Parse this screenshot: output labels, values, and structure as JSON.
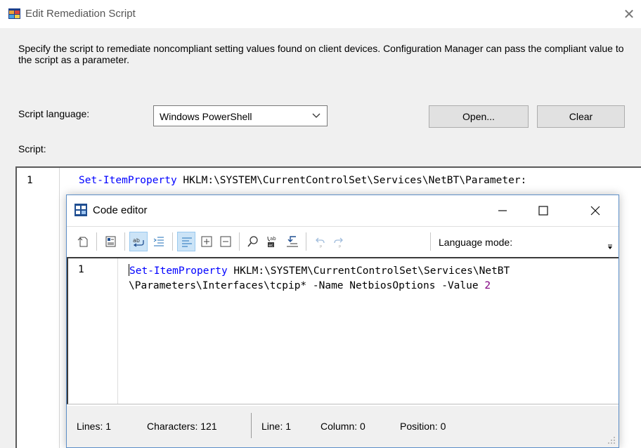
{
  "dialog": {
    "title": "Edit Remediation Script",
    "description": "Specify the script to remediate noncompliant setting values found on client devices. Configuration Manager can pass the compliant value to the script as a parameter.",
    "script_language_label": "Script language:",
    "script_language_value": "Windows PowerShell",
    "open_label": "Open...",
    "clear_label": "Clear",
    "script_label": "Script:"
  },
  "script_editor": {
    "line_number": "1",
    "code_keyword": "Set-ItemProperty",
    "code_rest": " HKLM:\\SYSTEM\\CurrentControlSet\\Services\\NetBT\\Parameter:"
  },
  "code_editor": {
    "title": "Code editor",
    "language_mode_label": "Language mode:",
    "line_number": "1",
    "code_keyword": "Set-ItemProperty",
    "code_line1_rest": " HKLM:\\SYSTEM\\CurrentControlSet\\Services\\NetBT",
    "code_line2": "\\Parameters\\Interfaces\\tcpip* -Name NetbiosOptions -Value ",
    "code_value": "2",
    "status": {
      "lines": "Lines: 1",
      "characters": "Characters: 121",
      "line": "Line: 1",
      "column": "Column: 0",
      "position": "Position: 0"
    }
  },
  "colors": {
    "keyword": "#0000ff",
    "number": "#800080",
    "toggle_on": "#cce4f7"
  },
  "icons": [
    "app-icon",
    "chevron-down-icon",
    "code-editor-icon",
    "minimize-icon",
    "maximize-icon",
    "close-icon",
    "new-document-icon",
    "properties-icon",
    "word-wrap-icon",
    "indent-icon",
    "align-icon",
    "expand-icon",
    "collapse-icon",
    "find-icon",
    "replace-icon",
    "go-to-icon",
    "undo-icon",
    "redo-icon",
    "overflow-icon",
    "resize-grip-icon"
  ]
}
